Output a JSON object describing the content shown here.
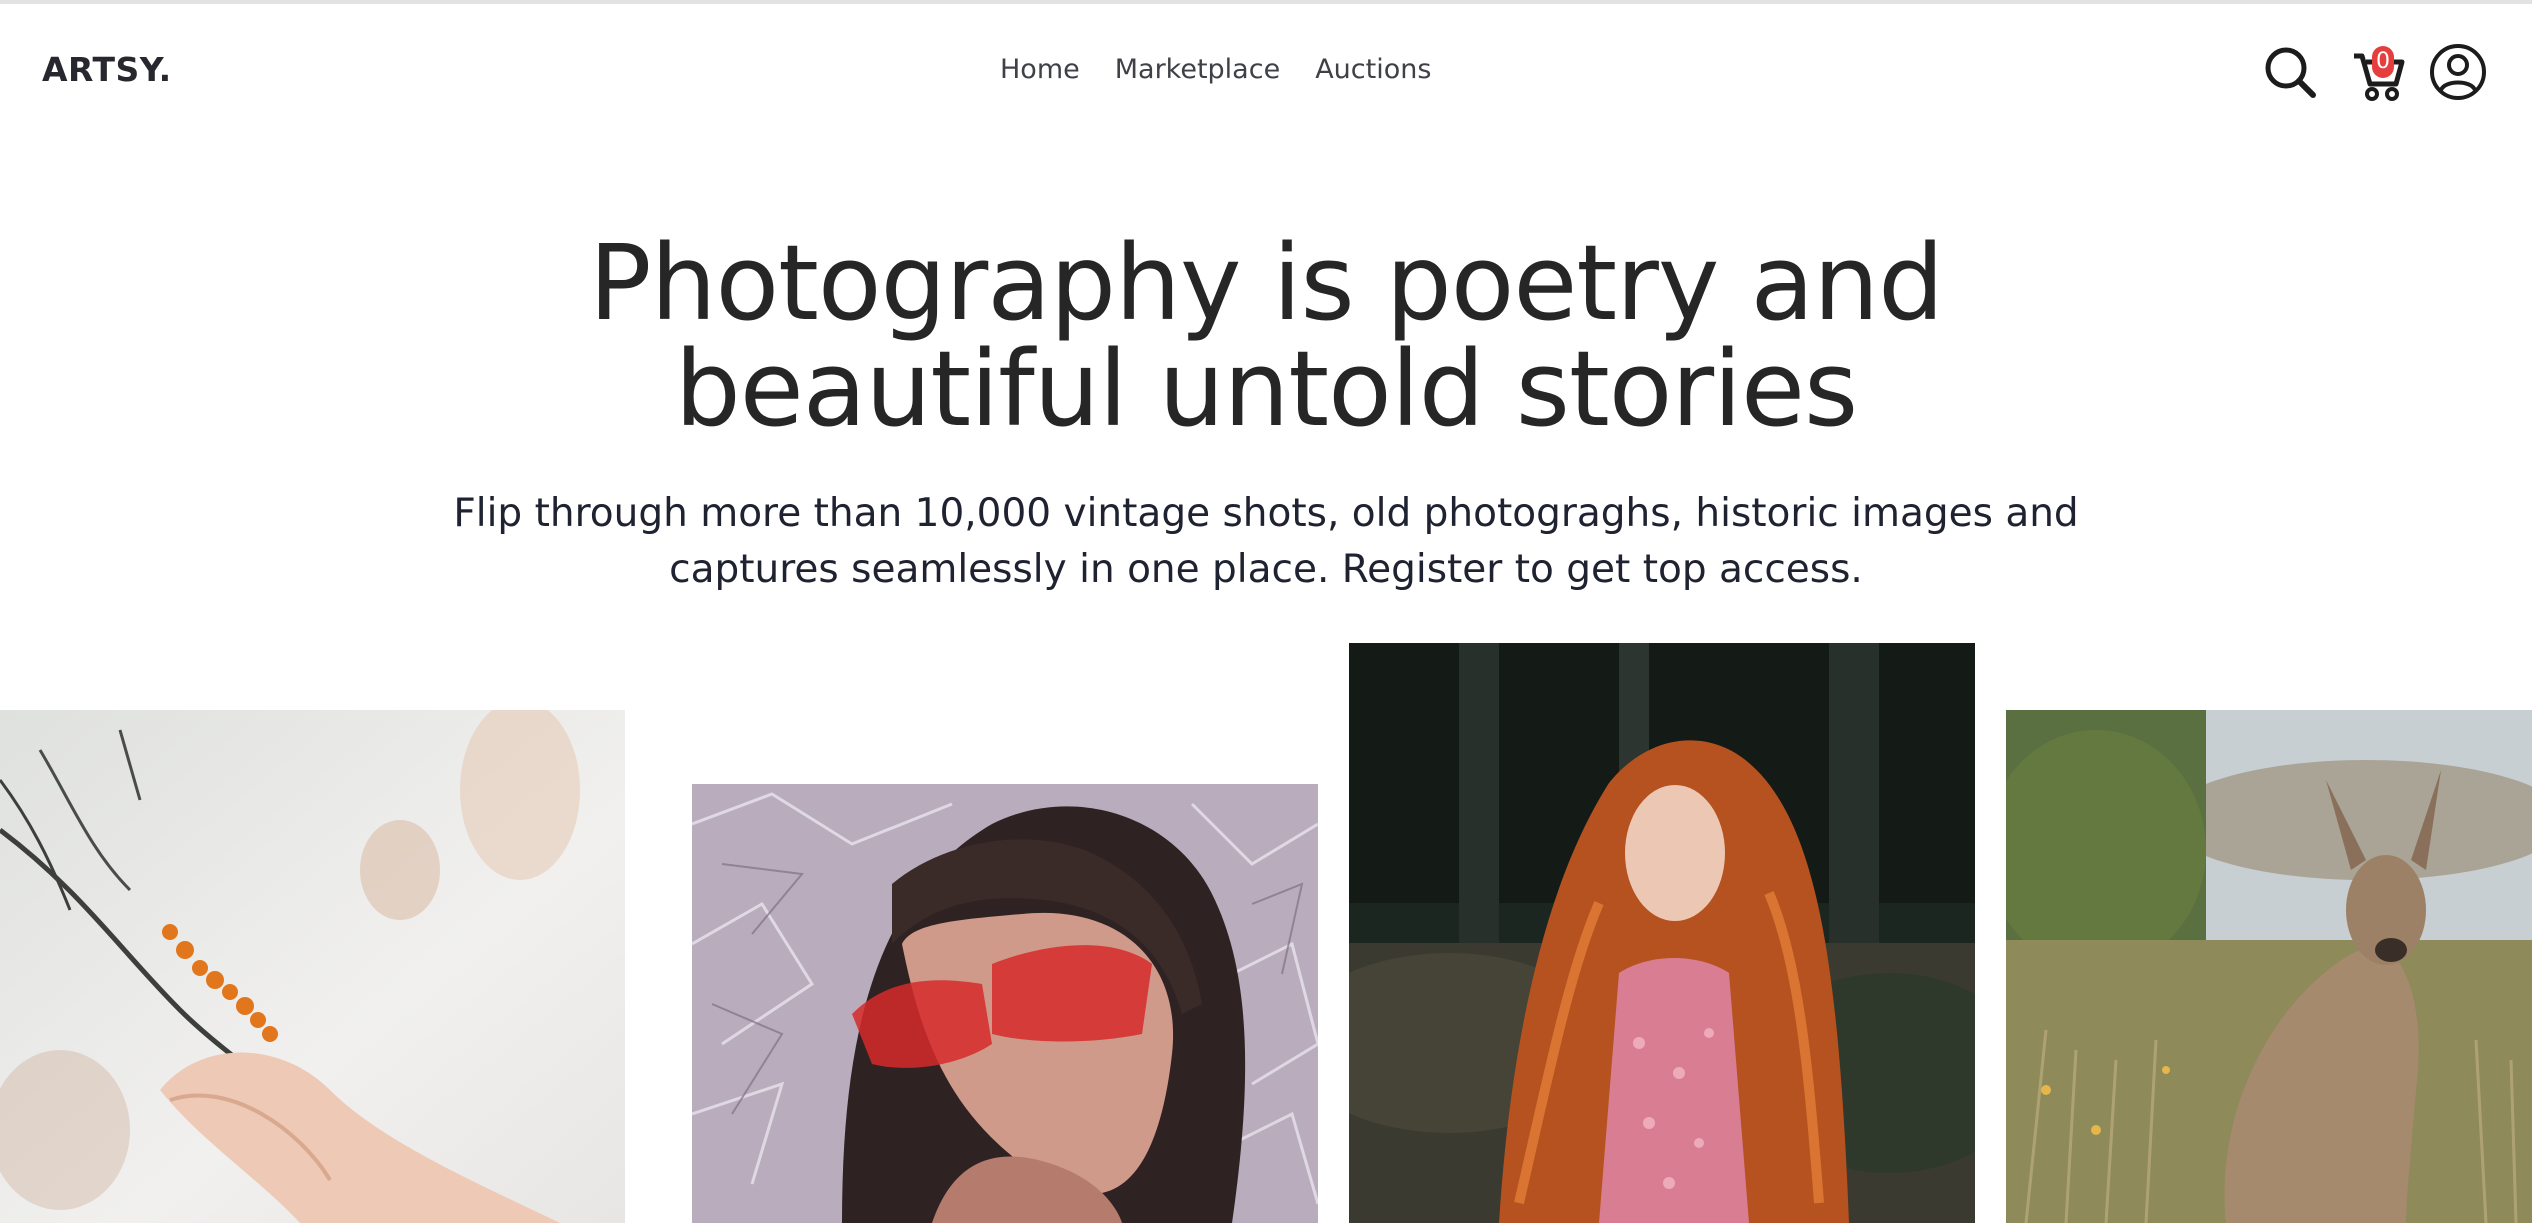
{
  "header": {
    "logo": "ARTSY.",
    "nav": [
      {
        "label": "Home"
      },
      {
        "label": "Marketplace"
      },
      {
        "label": "Auctions"
      }
    ],
    "icons": {
      "search": "search-icon",
      "cart": "cart-icon",
      "account": "user-icon"
    },
    "cart_count": "0"
  },
  "hero": {
    "title": "Photography is poetry and beautiful untold stories",
    "subtitle": "Flip through more than 10,000 vintage shots, old photograghs, historic images and captures seamlessly in one place. Register to get top access."
  },
  "gallery": {
    "photos": [
      {
        "subject": "hand reaching for orange sea buckthorn berries on a branch"
      },
      {
        "subject": "boy with red sunglasses against crumpled foil"
      },
      {
        "subject": "red curly-haired woman in pink floral dress in forest"
      },
      {
        "subject": "kangaroo standing in grassy field"
      }
    ]
  },
  "colors": {
    "text": "#262626",
    "badge": "#e53e3e",
    "nav": "#3f4147"
  }
}
